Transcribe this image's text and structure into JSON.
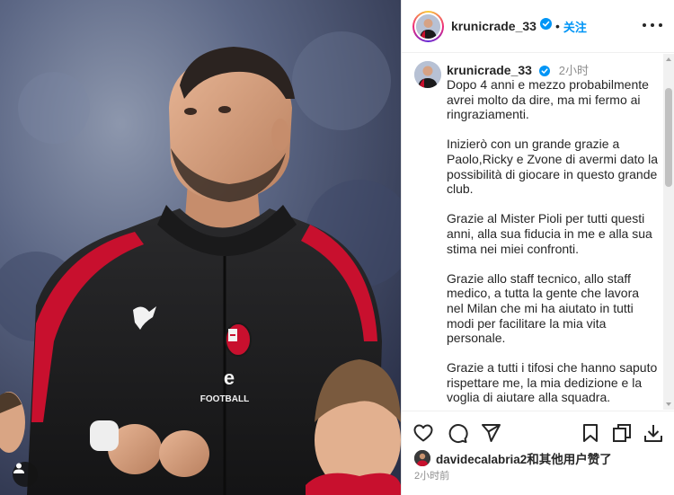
{
  "post": {
    "username": "krunicrade_33",
    "separator": "•",
    "follow_label": "关注",
    "caption_time": "2小时",
    "caption_paragraphs": [
      "Dopo 4 anni e mezzo probabilmente avrei molto da dire, ma mi fermo ai ringraziamenti.",
      "Inizierò con un grande grazie a Paolo,Ricky e Zvone di avermi dato la possibilità di giocare in questo grande club.",
      "Grazie al Mister Pioli per tutti questi anni, alla sua fiducia in me e alla sua stima nei miei confronti.",
      "Grazie allo staff tecnico, allo staff medico, a tutta la gente che lavora nel Milan che mi ha aiutato in tutti modi per facilitare la mia vita personale.",
      "Grazie a tutti i tifosi che hanno saputo rispettare me, la mia dedizione e la voglia di aiutare alla squadra."
    ],
    "likes_text": "davidecalabria2和其他用户赞了",
    "timestamp": "2小时前"
  },
  "photo": {
    "jersey_brand": "FOOTBALL"
  },
  "icons": {
    "like": "heart-icon",
    "comment": "comment-icon",
    "share": "share-icon",
    "save": "bookmark-icon",
    "copy": "copy-icon",
    "download": "download-icon",
    "more": "more-icon",
    "verified": "verified-badge-icon",
    "tags": "user-tag-icon"
  },
  "colors": {
    "link": "#0095f6",
    "verified": "#0095f6",
    "text": "#262626",
    "muted": "#8e8e8e"
  }
}
